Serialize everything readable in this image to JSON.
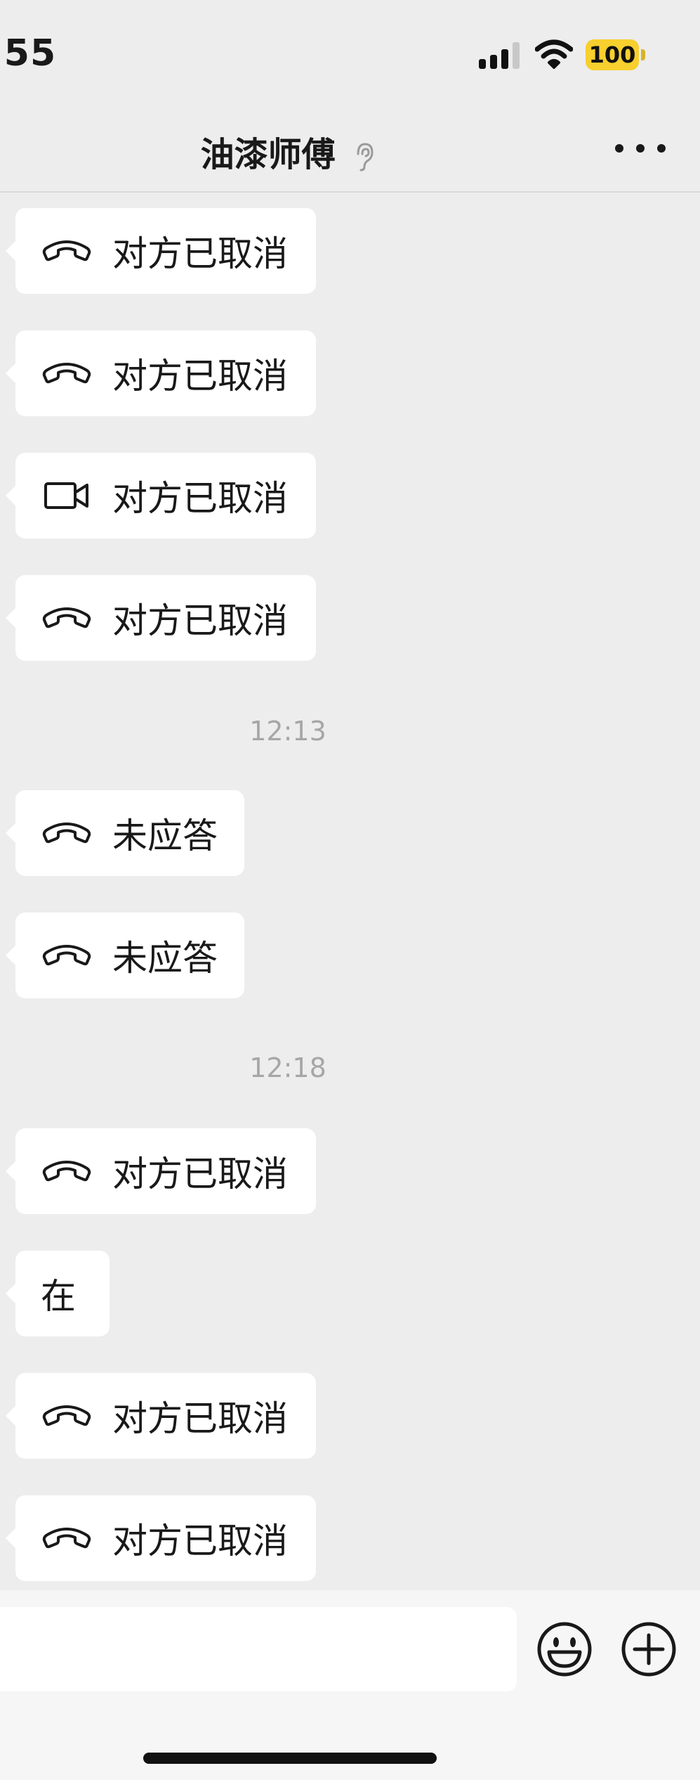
{
  "status_bar": {
    "time": ":55",
    "battery": "100"
  },
  "header": {
    "title": "油漆师傅"
  },
  "messages": [
    {
      "kind": "voice-call",
      "text": "对方已取消"
    },
    {
      "kind": "voice-call",
      "text": "对方已取消"
    },
    {
      "kind": "video-call",
      "text": "对方已取消"
    },
    {
      "kind": "voice-call",
      "text": "对方已取消"
    },
    {
      "kind": "timestamp",
      "text": "12:13"
    },
    {
      "kind": "voice-call",
      "text": "未应答"
    },
    {
      "kind": "voice-call",
      "text": "未应答"
    },
    {
      "kind": "timestamp",
      "text": "12:18"
    },
    {
      "kind": "voice-call",
      "text": "对方已取消"
    },
    {
      "kind": "text",
      "text": "在"
    },
    {
      "kind": "voice-call",
      "text": "对方已取消"
    },
    {
      "kind": "voice-call",
      "text": "对方已取消"
    }
  ],
  "input_bar": {
    "placeholder": ""
  },
  "icons": {
    "call": "phone-hangup-icon",
    "video": "video-camera-icon",
    "emoji": "emoji-icon",
    "more": "plus-circle-icon",
    "header_more": "more-dots-icon",
    "listen": "ear-icon"
  },
  "colors": {
    "background": "#ededed",
    "bubble": "#ffffff",
    "battery": "#f7cf2e",
    "timestamp": "#a6a6a6"
  }
}
